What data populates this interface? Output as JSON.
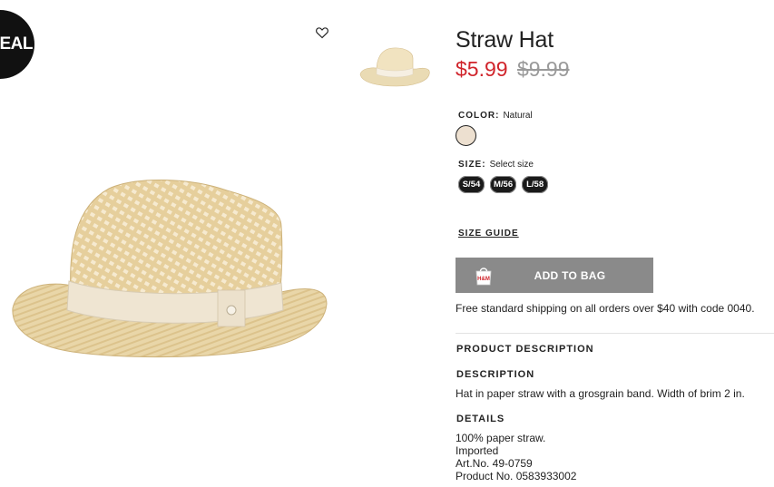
{
  "badge": {
    "label": "DEAL"
  },
  "product": {
    "title": "Straw Hat",
    "sale_price": "$5.99",
    "original_price": "$9.99"
  },
  "color": {
    "label": "COLOR:",
    "value": "Natural",
    "swatch_hex": "#ede0d0"
  },
  "size": {
    "label": "SIZE:",
    "value": "Select size",
    "options": [
      "S/54",
      "M/56",
      "L/58"
    ]
  },
  "size_guide": "SIZE GUIDE",
  "add_to_bag": {
    "label": "ADD TO BAG",
    "icon_text": "H&M",
    "button_color": "#8a8a8a"
  },
  "shipping_note": "Free standard shipping on all orders over $40 with code 0040.",
  "product_description": {
    "heading": "PRODUCT DESCRIPTION",
    "description_heading": "DESCRIPTION",
    "description_text": "Hat in paper straw with a grosgrain band. Width of brim 2 in.",
    "details_heading": "DETAILS",
    "details": [
      "100% paper straw.",
      "Imported",
      "Art.No. 49-0759",
      "Product No. 0583933002"
    ]
  },
  "colors": {
    "sale": "#d0242b",
    "old_price": "#9a9a9a",
    "text": "#222222"
  },
  "icons": {
    "favorite": "heart-outline-icon",
    "bag": "shopping-bag-icon"
  }
}
